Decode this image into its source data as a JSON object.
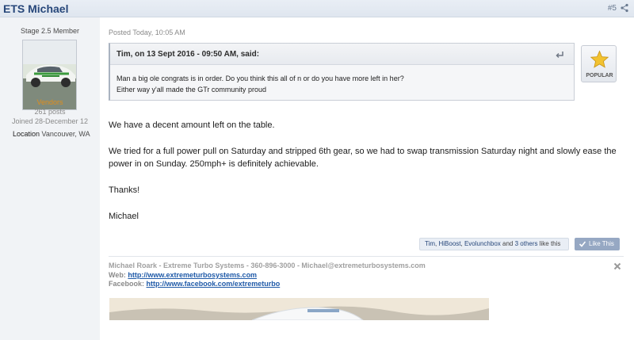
{
  "header": {
    "author": "ETS Michael",
    "post_number": "#5",
    "share_icon": "share-icon"
  },
  "sidebar": {
    "rank": "Stage 2.5 Member",
    "group": "Vendors",
    "posts": "261 posts",
    "joined": "Joined 28-December 12",
    "location_label": "Location",
    "location_value": "Vancouver, WA"
  },
  "post": {
    "posted": "Posted Today, 10:05 AM",
    "quote": {
      "citation": "Tim, on 13 Sept 2016 - 09:50 AM, said:",
      "line1": "Man a big ole congrats is in order. Do you think this all of n or do you have more left in her?",
      "line2": "Either way y'all made the GTr community proud"
    },
    "popular_label": "POPULAR",
    "body": [
      "We have a decent amount left on the table.",
      "We tried for a full power pull on Saturday and stripped 6th gear, so we had to swap transmission Saturday night and slowly ease the power in on Sunday.  250mph+ is definitely achievable.",
      "Thanks!",
      "Michael"
    ],
    "likes": {
      "users": [
        "Tim",
        "HiBoost",
        "Evolunchbox"
      ],
      "and": "and",
      "others": "3 others",
      "suffix": "like this",
      "button": "Like This"
    }
  },
  "signature": {
    "line1": "Michael Roark - Extreme Turbo Systems - 360-896-3000 - Michael@extremeturbosystems.com",
    "web_label": "Web:",
    "web_url": "http://www.extremeturbosystems.com",
    "fb_label": "Facebook:",
    "fb_url": "http://www.facebook.com/extremeturbo"
  },
  "colors": {
    "accent": "#27477a",
    "vendor": "#e08e1b",
    "link": "#1f5aa8",
    "like_button": "#96a8c3"
  }
}
